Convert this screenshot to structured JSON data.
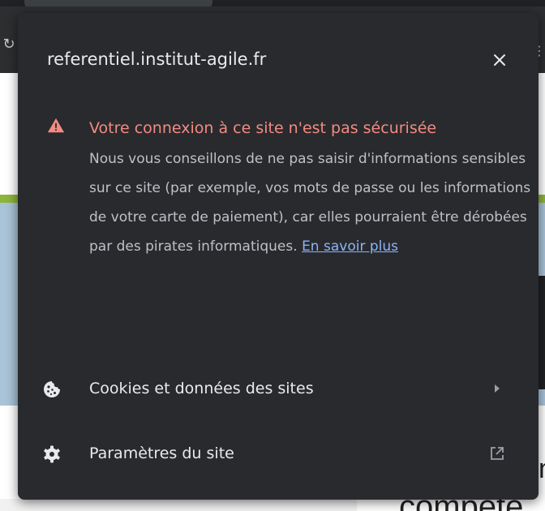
{
  "popup": {
    "title": "referentiel.institut-agile.fr",
    "warning": {
      "title": "Votre connexion à ce site n'est pas sécurisée",
      "body": "Nous vous conseillons de ne pas saisir d'informations sensibles sur ce site (par exemple, vos mots de passe ou les informations de votre carte de paiement), car elles pourraient être dérobées par des pirates informatiques.",
      "link": "En savoir plus"
    },
    "items": [
      {
        "label": "Cookies et données des sites",
        "icon": "cookie-icon",
        "trailing": "chevron-right-icon"
      },
      {
        "label": "Paramètres du site",
        "icon": "gear-icon",
        "trailing": "open-in-new-icon"
      }
    ]
  },
  "background_page": {
    "visible_text_fragment": "compete",
    "visible_text_fragment_right": "n"
  },
  "colors": {
    "popup_background": "#292a2d",
    "warning_red": "#f28b82",
    "link_blue": "#8ab4f8",
    "text_primary": "#e8eaed",
    "text_secondary": "#bdc1c6"
  }
}
